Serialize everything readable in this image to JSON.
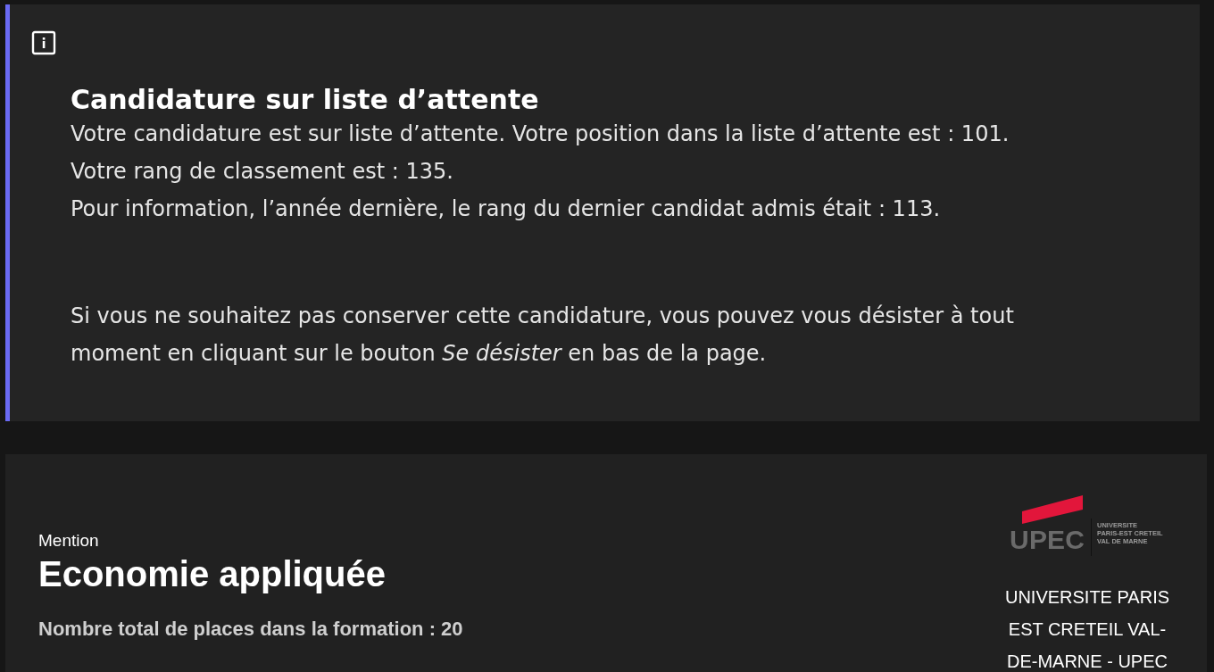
{
  "notice": {
    "title": "Candidature sur liste d’attente",
    "lines": [
      "Votre candidature est sur liste d’attente. Votre position dans la liste d’attente est : 101.",
      "Votre rang de classement est : 135.",
      "Pour information, l’année dernière, le rang du dernier candidat admis était : 113."
    ],
    "note": "Si vous ne souhaitez pas conserver cette candidature, vous pouvez vous désister à tout moment en cliquant sur le bouton *Se désister* en bas de la page."
  },
  "formation": {
    "label": "Mention",
    "name": "Economie appliquée",
    "places": "Nombre total de places dans la formation : 20",
    "logo": {
      "wordmark": "UPEC",
      "subtitle": [
        "UNIVERSITE",
        "PARIS-EST CRETEIL",
        "VAL DE MARNE"
      ]
    },
    "school": "UNIVERSITE PARIS EST CRETEIL VAL-DE-MARNE - UPEC"
  }
}
